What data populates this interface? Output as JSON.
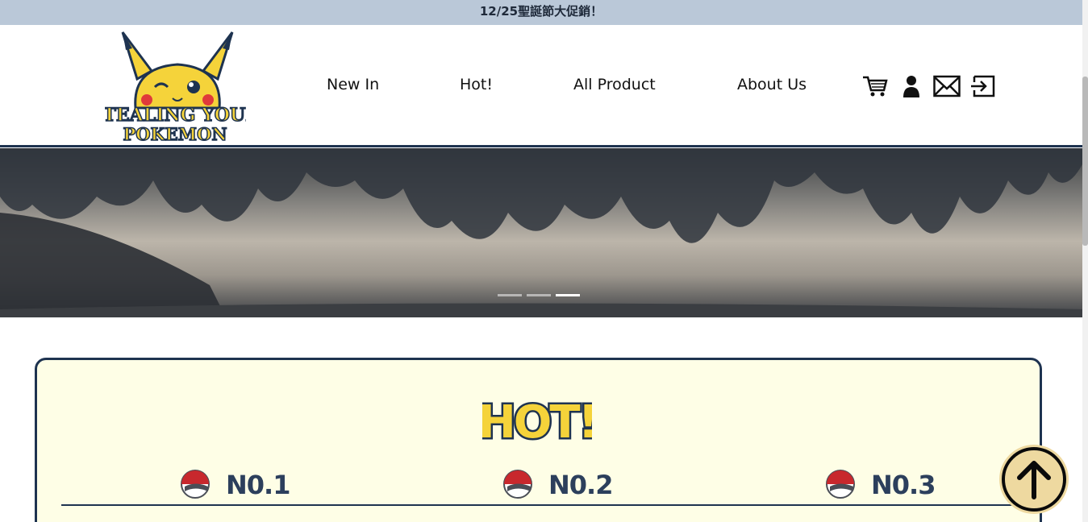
{
  "promo": {
    "text": "12/25聖誕節大促銷！"
  },
  "header": {
    "logo_line1": "STEALING YOUR",
    "logo_line2": "POKEMON",
    "nav": [
      {
        "label": "New In"
      },
      {
        "label": "Hot!"
      },
      {
        "label": "All Product"
      },
      {
        "label": "About Us"
      }
    ],
    "icons": [
      "cart-icon",
      "user-icon",
      "mail-icon",
      "logout-icon"
    ]
  },
  "hero": {
    "slide_count": 3,
    "active_slide": 3
  },
  "hot": {
    "title": "HOT!",
    "ranks": [
      {
        "label": "N0.1"
      },
      {
        "label": "N0.2"
      },
      {
        "label": "N0.3"
      }
    ]
  },
  "colors": {
    "promo_bg": "#bac8d8",
    "navy": "#1e3350",
    "panel_bg": "#fefee6",
    "accent_yellow": "#f5d33a",
    "totop_bg": "#eed9a0"
  }
}
